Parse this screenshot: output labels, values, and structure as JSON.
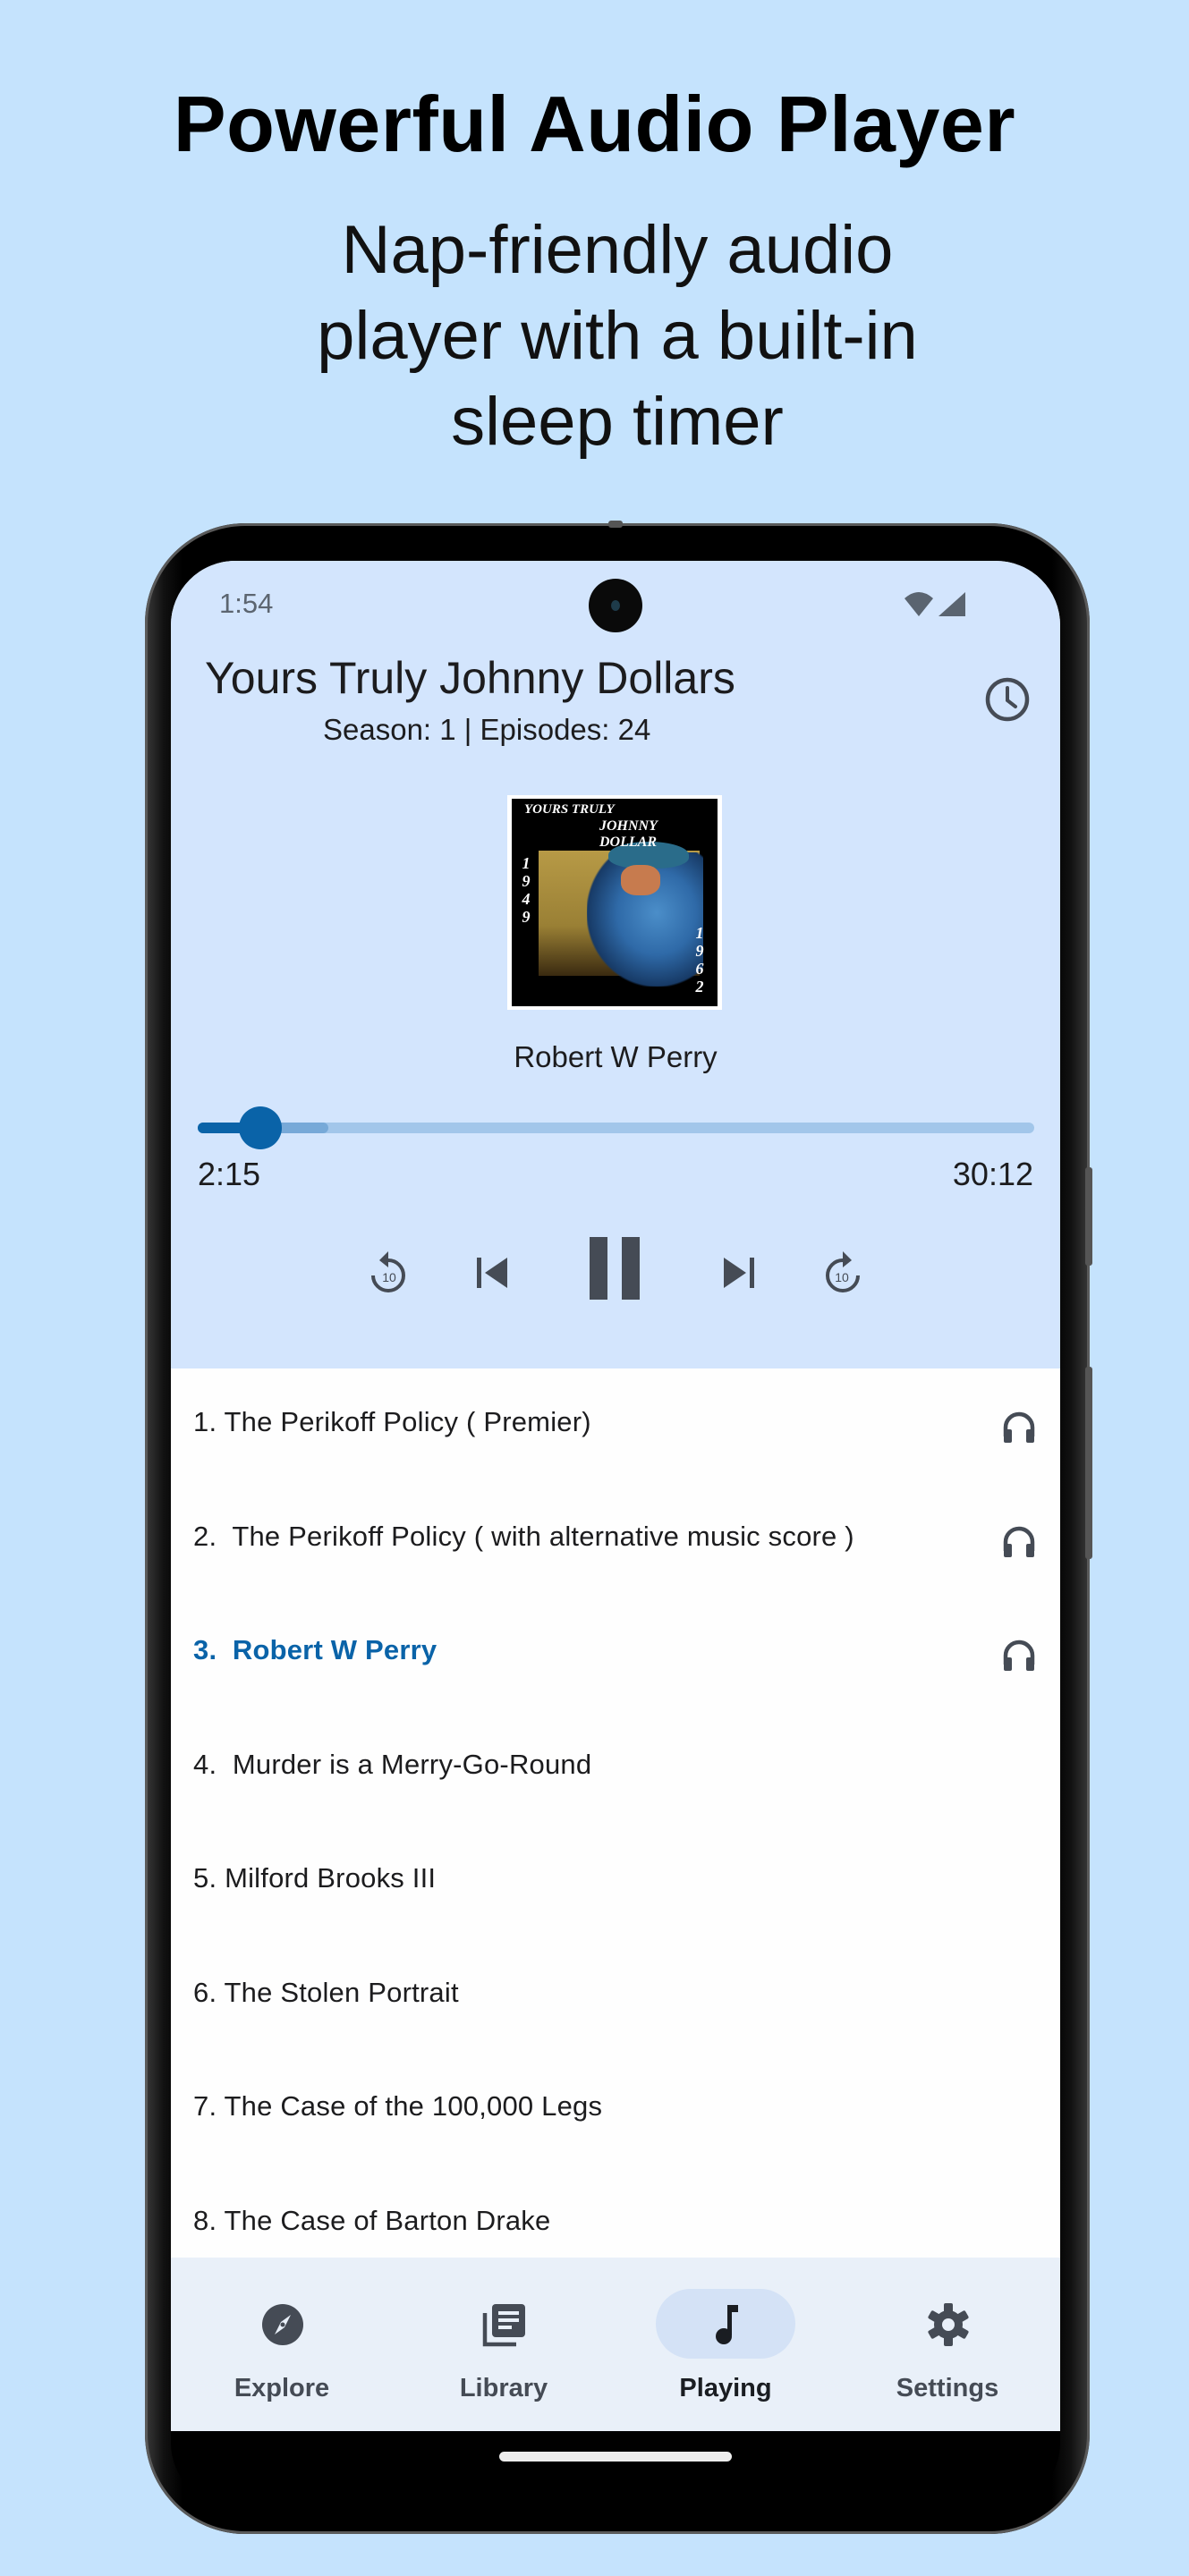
{
  "promo": {
    "headline": "Powerful Audio Player",
    "subtitle_lines": [
      "Nap-friendly audio",
      "player with a built-in",
      "sleep timer"
    ]
  },
  "status_bar": {
    "time": "1:54",
    "icons": [
      "wifi-icon",
      "cellular-signal-icon"
    ]
  },
  "player": {
    "show_title": "Yours Truly Johnny Dollars",
    "show_meta": "Season: 1 | Episodes: 24",
    "sleep_timer_icon": "clock-icon",
    "cover_art": {
      "title_line1": "YOURS TRULY",
      "title_line2": "JOHNNY DOLLAR",
      "year_start": "1949",
      "year_end": "1962"
    },
    "now_playing": "Robert W Perry",
    "position": "2:15",
    "duration": "30:12",
    "progress_fraction": 0.075,
    "buffered_fraction": 0.156,
    "controls": [
      {
        "name": "rewind-10",
        "label": "10"
      },
      {
        "name": "skip-previous"
      },
      {
        "name": "pause"
      },
      {
        "name": "skip-next"
      },
      {
        "name": "forward-10",
        "label": "10"
      }
    ],
    "accent_color": "#0a63a8"
  },
  "episodes": [
    {
      "label": "1. The Perikoff Policy ( Premier)",
      "listened": true,
      "active": false
    },
    {
      "label": "2.  The Perikoff Policy ( with alternative music score )",
      "listened": true,
      "active": false
    },
    {
      "label": "3.  Robert W Perry",
      "listened": true,
      "active": true
    },
    {
      "label": "4.  Murder is a Merry-Go-Round",
      "listened": false,
      "active": false
    },
    {
      "label": "5. Milford Brooks III",
      "listened": false,
      "active": false
    },
    {
      "label": "6. The Stolen Portrait",
      "listened": false,
      "active": false
    },
    {
      "label": "7. The Case of the 100,000 Legs",
      "listened": false,
      "active": false
    },
    {
      "label": "8. The Case of Barton Drake",
      "listened": false,
      "active": false
    }
  ],
  "nav": {
    "items": [
      {
        "label": "Explore",
        "icon": "compass-icon",
        "active": false
      },
      {
        "label": "Library",
        "icon": "library-icon",
        "active": false
      },
      {
        "label": "Playing",
        "icon": "music-note-icon",
        "active": true
      },
      {
        "label": "Settings",
        "icon": "gear-icon",
        "active": false
      }
    ]
  }
}
